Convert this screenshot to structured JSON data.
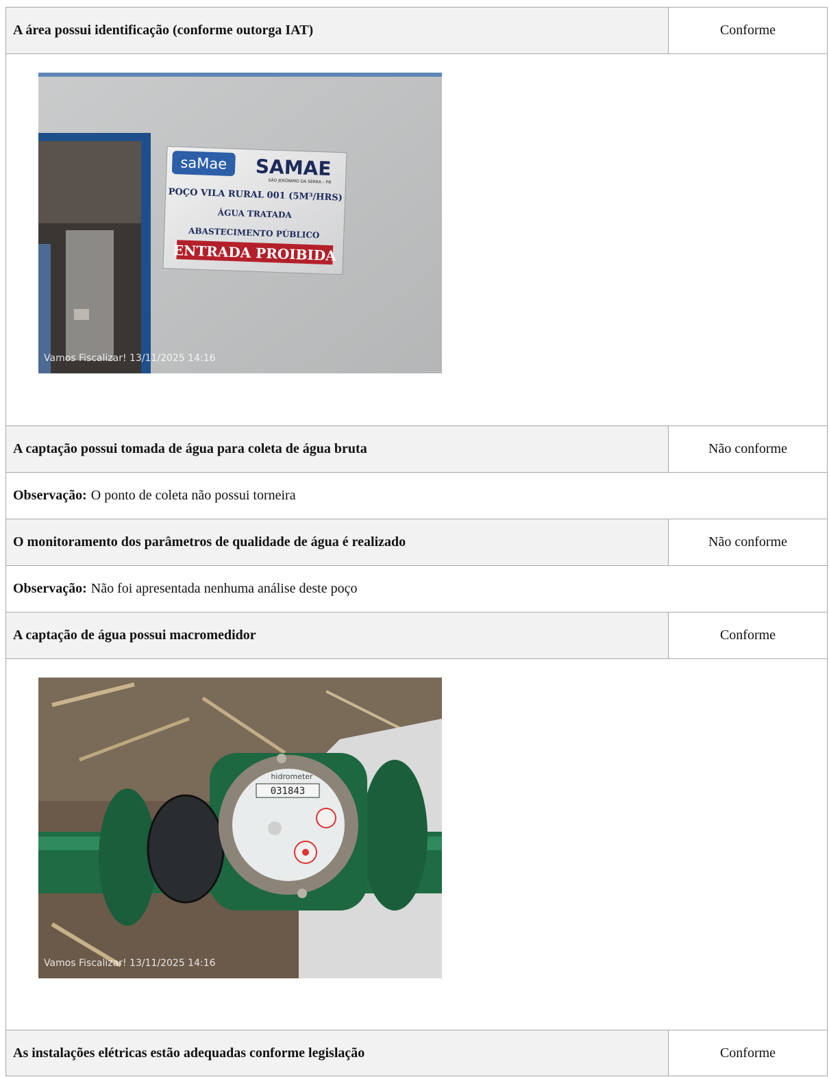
{
  "items": [
    {
      "question": "A área possui identificação (conforme outorga IAT)",
      "status": "Conforme"
    },
    {
      "question": "A captação possui tomada de água para coleta de água bruta",
      "status": "Não conforme"
    },
    {
      "question": "O monitoramento dos parâmetros de qualidade de água é realizado",
      "status": "Não conforme"
    },
    {
      "question": "A captação de água possui macromedidor",
      "status": "Conforme"
    },
    {
      "question": "As instalações elétricas estão adequadas conforme legislação",
      "status": "Conforme"
    }
  ],
  "observations": [
    {
      "label": "Observação:",
      "text": "O ponto de coleta não possui torneira"
    },
    {
      "label": "Observação:",
      "text": "Não foi apresentada nenhuma análise deste poço"
    }
  ],
  "photos": [
    {
      "stamp": "Vamos Fiscalizar!  13/11/2025 14:16",
      "sign": {
        "logo": "saMae",
        "brand": "SAMAE",
        "city": "SÃO JERÔNIMO DA SERRA – PR",
        "line1": "POÇO VILA RURAL 001 (5M³/HRS)",
        "line2": "ÁGUA TRATADA",
        "line3": "ABASTECIMENTO PÚBLICO",
        "warning": "ENTRADA PROIBIDA"
      }
    },
    {
      "stamp": "Vamos Fiscalizar!  13/11/2025 14:16",
      "meter": {
        "brand": "hidrometer",
        "reading": "031843"
      }
    }
  ]
}
